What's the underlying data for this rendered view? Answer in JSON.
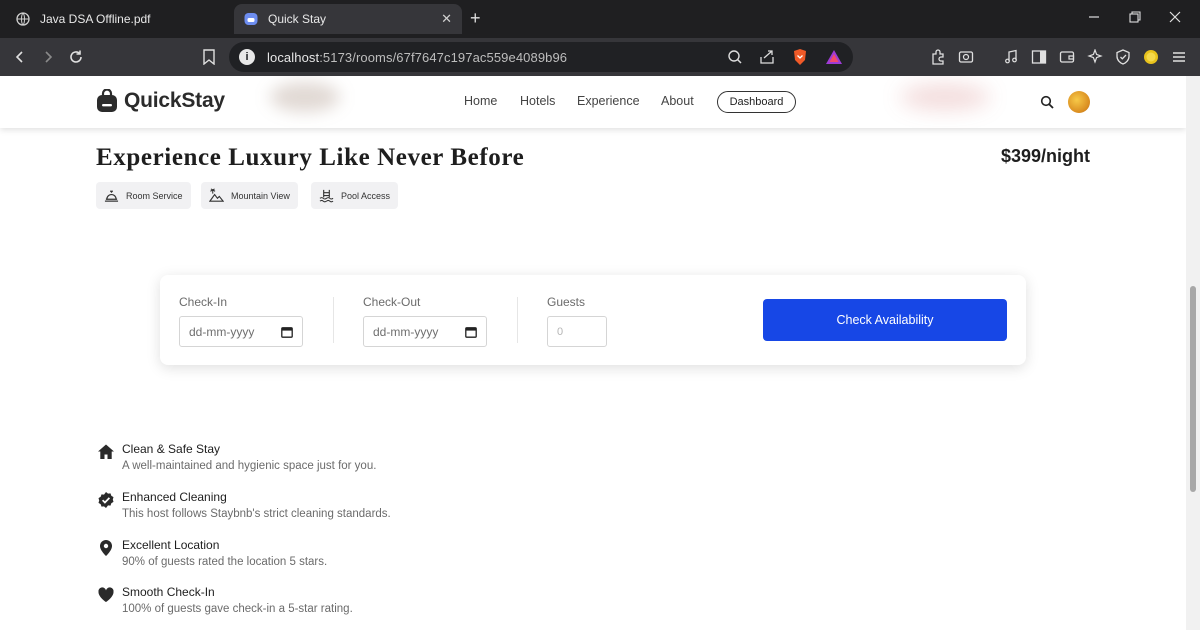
{
  "browser": {
    "tabs": [
      {
        "title": "Java DSA Offline.pdf",
        "active": false
      },
      {
        "title": "Quick Stay",
        "active": true
      }
    ],
    "url_host": "localhost",
    "url_rest": ":5173/rooms/67f7647c197ac559e4089b96"
  },
  "navbar": {
    "logo_text": "QuickStay",
    "links": [
      "Home",
      "Hotels",
      "Experience",
      "About"
    ],
    "dashboard_label": "Dashboard"
  },
  "room": {
    "title": "Experience Luxury Like Never Before",
    "price": "$399/night",
    "amenities": [
      "Room Service",
      "Mountain View",
      "Pool Access"
    ]
  },
  "booking": {
    "checkin_label": "Check-In",
    "checkin_placeholder": "dd-mm-yyyy",
    "checkout_label": "Check-Out",
    "checkout_placeholder": "dd-mm-yyyy",
    "guests_label": "Guests",
    "guests_placeholder": "0",
    "button_label": "Check Availability"
  },
  "features": [
    {
      "icon": "home-icon",
      "title": "Clean & Safe Stay",
      "description": "A well-maintained and hygienic space just for you."
    },
    {
      "icon": "badge-check-icon",
      "title": "Enhanced Cleaning",
      "description": "This host follows Staybnb's strict cleaning standards."
    },
    {
      "icon": "location-pin-icon",
      "title": "Excellent Location",
      "description": "90% of guests rated the location 5 stars."
    },
    {
      "icon": "heart-icon",
      "title": "Smooth Check-In",
      "description": "100% of guests gave check-in a 5-star rating."
    }
  ],
  "colors": {
    "primary_button": "#1747e6",
    "browser_dark": "#1f1f21",
    "toolbar": "#36363a"
  }
}
